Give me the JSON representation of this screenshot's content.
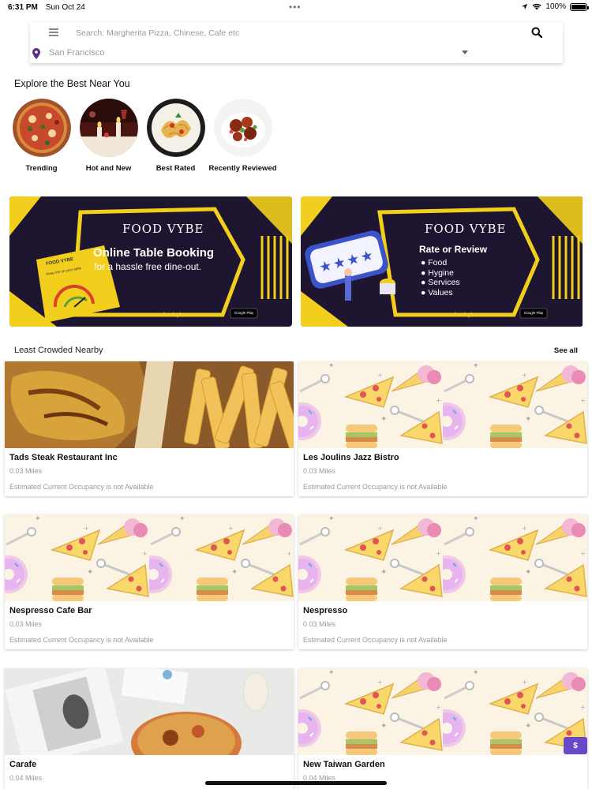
{
  "status_bar": {
    "time": "6:31 PM",
    "date": "Sun Oct 24",
    "battery": "100%",
    "battery_level": 1.0
  },
  "search": {
    "placeholder": "Search: Margherita Pizza, Chinese, Cafe etc",
    "location": "San Francisco"
  },
  "explore": {
    "title": "Explore the Best Near You",
    "categories": [
      {
        "label": "Trending",
        "icon": "pizza-photo"
      },
      {
        "label": "Hot and New",
        "icon": "candle-dinner-photo"
      },
      {
        "label": "Best Rated",
        "icon": "pasta-photo"
      },
      {
        "label": "Recently Reviewed",
        "icon": "meat-dish-photo"
      }
    ]
  },
  "banners": [
    {
      "brand": "FOOD VYBE",
      "headline": "Online Table Booking",
      "subline": "for a hassle free dine-out.",
      "booklet_brand": "FOOD VYBE",
      "booklet_text": "Keep me on your table",
      "url": "www.foodvybe.com",
      "store_badge": "Google Play"
    },
    {
      "brand": "FOOD VYBE",
      "headline": "Rate or Review",
      "bullets": [
        "Food",
        "Hygine",
        "Services",
        "Values"
      ],
      "url": "www.foodvybe.com",
      "store_badge": "Google Play"
    }
  ],
  "nearby": {
    "title": "Least Crowded Nearby",
    "see_all": "See all",
    "restaurants": [
      {
        "name": "Tads Steak Restaurant Inc",
        "distance": "0.03 Miles",
        "occupancy": "Estimated Current Occupancy is not Available",
        "image": "steak-fries-photo"
      },
      {
        "name": "Les Joulins Jazz Bistro",
        "distance": "0.03 Miles",
        "occupancy": "Estimated Current Occupancy is not Available",
        "image": "food-pattern"
      },
      {
        "name": "Nespresso Cafe Bar",
        "distance": "0.03 Miles",
        "occupancy": "Estimated Current Occupancy is not Available",
        "image": "food-pattern"
      },
      {
        "name": "Nespresso",
        "distance": "0.03 Miles",
        "occupancy": "Estimated Current Occupancy is not Available",
        "image": "food-pattern"
      },
      {
        "name": "Carafe",
        "distance": "0.04 Miles",
        "occupancy": "",
        "image": "coffee-table-photo"
      },
      {
        "name": "New Taiwan Garden",
        "distance": "0.04 Miles",
        "occupancy": "",
        "image": "food-pattern"
      }
    ]
  },
  "pay_badge": "$",
  "colors": {
    "brand_purple": "#6a49c8",
    "banner_dark": "#1e1530",
    "banner_yellow": "#f2cf1d",
    "pin_purple": "#5b2d8e"
  }
}
